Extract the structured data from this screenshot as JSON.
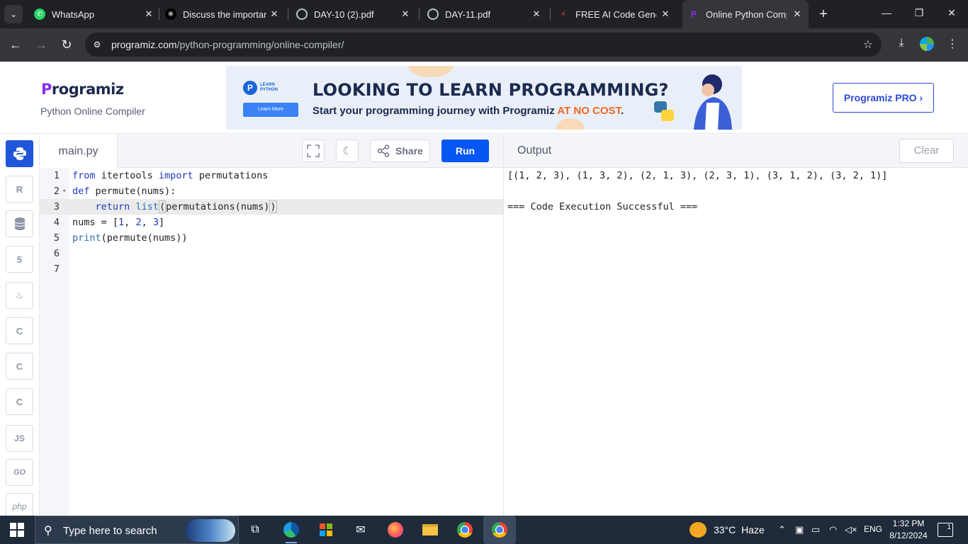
{
  "browser": {
    "tabs": [
      {
        "title": "WhatsApp"
      },
      {
        "title": "Discuss the importance"
      },
      {
        "title": "DAY-10 (2).pdf"
      },
      {
        "title": "DAY-11.pdf"
      },
      {
        "title": "FREE AI Code Generator"
      },
      {
        "title": "Online Python Compiler"
      }
    ],
    "url_domain": "programiz.com",
    "url_path": "/python-programming/online-compiler/"
  },
  "header": {
    "logo_p": "P",
    "logo_rest": "rogramiz",
    "subtitle": "Python Online Compiler",
    "pro_button": "Programiz PRO ›"
  },
  "banner": {
    "badge_letter": "P",
    "badge_text_1": "LEARN",
    "badge_text_2": "PYTHON",
    "learn_more": "Learn More",
    "title": "LOOKING TO LEARN PROGRAMMING?",
    "subtitle_prefix": "Start your programming journey with Programiz ",
    "subtitle_highlight": "AT NO COST",
    "subtitle_suffix": "."
  },
  "sidebar": {
    "languages": [
      {
        "name": "python",
        "label": ""
      },
      {
        "name": "r",
        "label": "R"
      },
      {
        "name": "sql",
        "label": ""
      },
      {
        "name": "html",
        "label": "5"
      },
      {
        "name": "java",
        "label": ""
      },
      {
        "name": "c",
        "label": "C"
      },
      {
        "name": "cpp",
        "label": "C"
      },
      {
        "name": "csharp",
        "label": "C"
      },
      {
        "name": "javascript",
        "label": "JS"
      },
      {
        "name": "go",
        "label": "GO"
      },
      {
        "name": "php",
        "label": "php"
      }
    ]
  },
  "editor": {
    "filename": "main.py",
    "share_label": "Share",
    "run_label": "Run",
    "line_numbers": [
      "1",
      "2",
      "3",
      "4",
      "5",
      "6",
      "7"
    ],
    "active_line": 3
  },
  "output": {
    "title": "Output",
    "clear_label": "Clear",
    "lines": [
      "[(1, 2, 3), (1, 3, 2), (2, 1, 3), (2, 3, 1), (3, 1, 2), (3, 2, 1)]",
      "=== Code Execution Successful ==="
    ]
  },
  "taskbar": {
    "search_placeholder": "Type here to search",
    "temperature": "33°C",
    "weather": "Haze",
    "language": "ENG",
    "time": "1:32 PM",
    "date": "8/12/2024",
    "notifications": "1"
  }
}
